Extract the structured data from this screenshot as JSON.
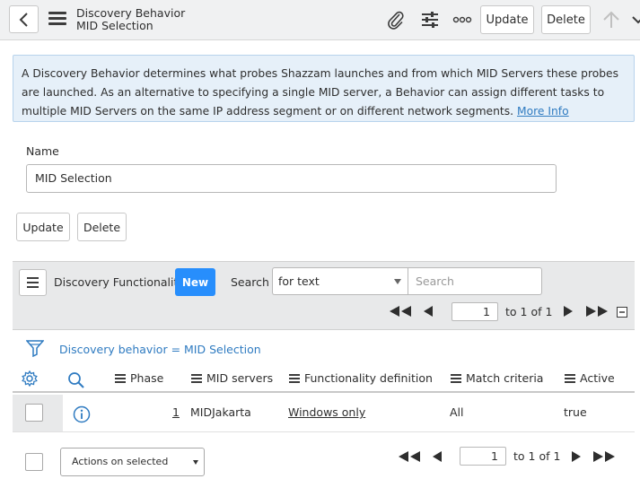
{
  "header": {
    "title": "Discovery Behavior",
    "subtitle": "MID Selection",
    "update_label": "Update",
    "delete_label": "Delete"
  },
  "info": {
    "text": "A Discovery Behavior determines what probes Shazzam launches and from which MID Servers these probes are launched. As an alternative to specifying a single MID server, a Behavior can assign different tasks to multiple MID Servers on the same IP address segment or on different network segments.",
    "more_info": "More Info"
  },
  "form": {
    "name_label": "Name",
    "name_value": "MID Selection",
    "update_label": "Update",
    "delete_label": "Delete"
  },
  "list": {
    "title": "Discovery Functionality",
    "new_label": "New",
    "search_label": "Search",
    "search_field_value": "for text",
    "search_placeholder": "Search",
    "page_value": "1",
    "page_text": "to 1 of 1",
    "filter_text": "Discovery behavior = MID Selection",
    "columns": [
      "Phase",
      "MID servers",
      "Functionality definition",
      "Match criteria",
      "Active"
    ],
    "rows": [
      {
        "phase": "1",
        "mid_servers": "MIDJakarta",
        "functionality_definition": "Windows only",
        "match_criteria": "All",
        "active": "true"
      }
    ],
    "actions_label": "Actions on selected rows...",
    "footer_page_value": "1",
    "footer_page_text": "to 1 of 1"
  },
  "colors": {
    "accent": "#278efc",
    "link": "#2f7bc1",
    "info_bg": "#e6f0f9"
  }
}
